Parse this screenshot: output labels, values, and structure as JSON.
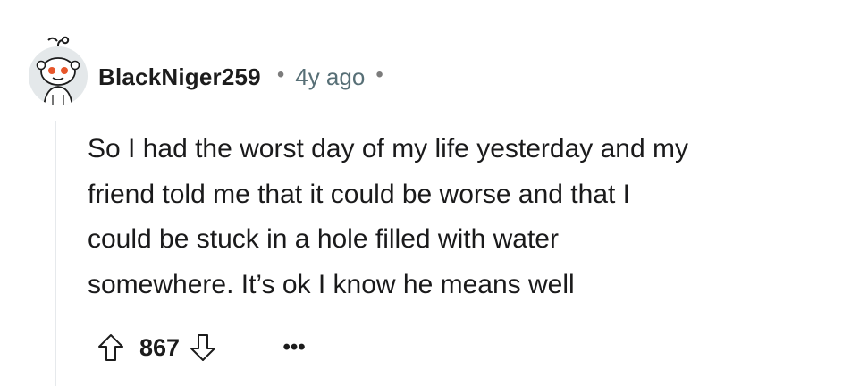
{
  "comment": {
    "author": "BlackNiger259",
    "separator": "•",
    "time_ago": "4y ago",
    "body_lines": [
      "So I had the worst day of my life yesterday and my",
      "friend told me that it could be worse and that I",
      "could be stuck in a hole filled with water",
      "somewhere. It’s ok I know he means well"
    ],
    "score": "867",
    "more_label": "•••",
    "icons": {
      "avatar": "snoo-avatar-icon",
      "upvote": "arrow-up-icon",
      "downvote": "arrow-down-icon",
      "more": "ellipsis-icon"
    }
  },
  "colors": {
    "text": "#1a1a1b",
    "muted": "#576f76",
    "thread_line": "#e6e9ec",
    "avatar_eye": "#e7562b"
  }
}
